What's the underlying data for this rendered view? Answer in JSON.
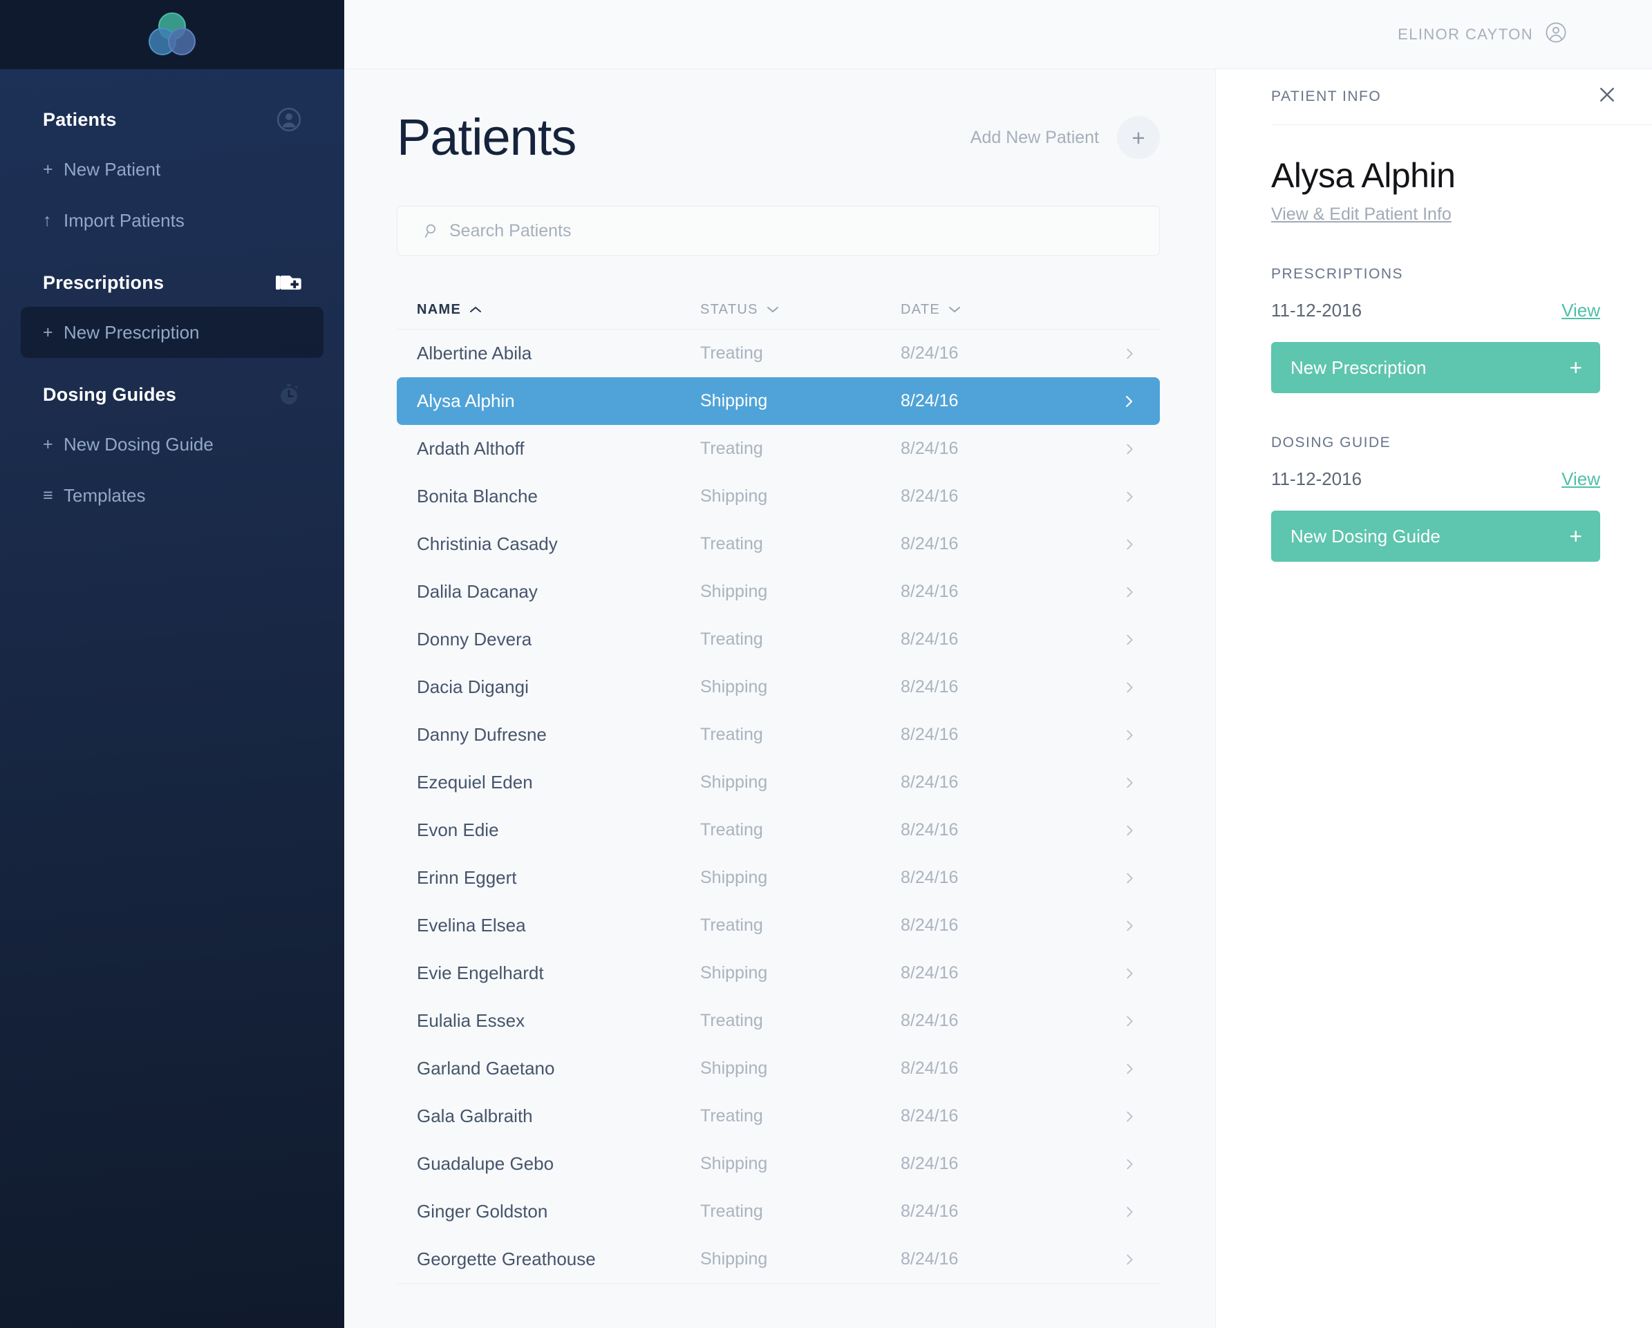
{
  "brand": {
    "logo_name": "three-circles-logo",
    "colors": {
      "sidebar_top": "#101A2E",
      "sidebar_body": "#1D3158",
      "accent_green": "#5EC5AE",
      "accent_blue": "#4FA3D8",
      "page_bg": "#F7F9FB",
      "panel_bg": "#FFFFFF",
      "title_navy": "#16233C"
    }
  },
  "topbar": {
    "user_name": "ELINOR CAYTON",
    "user_icon": "user-circle-icon"
  },
  "sidebar": {
    "groups": [
      {
        "label": "Patients",
        "icon": "user-circle-icon",
        "items": [
          {
            "marker": "+",
            "label": "New Patient",
            "active": false
          },
          {
            "marker": "↑",
            "label": "Import Patients",
            "active": false
          }
        ]
      },
      {
        "label": "Prescriptions",
        "icon": "medical-bag-icon",
        "items": [
          {
            "marker": "+",
            "label": "New Prescription",
            "active": true
          }
        ]
      },
      {
        "label": "Dosing Guides",
        "icon": "stopwatch-icon",
        "items": [
          {
            "marker": "+",
            "label": "New Dosing Guide",
            "active": false
          },
          {
            "marker": "≡",
            "label": "Templates",
            "active": false
          }
        ]
      }
    ]
  },
  "main": {
    "page_title": "Patients",
    "add_patient_label": "Add New Patient",
    "add_patient_plus": "+",
    "search": {
      "placeholder": "Search Patients",
      "value": "",
      "icon": "search-icon"
    },
    "table": {
      "columns": [
        {
          "label": "NAME",
          "sort": "asc",
          "caret": "⌃"
        },
        {
          "label": "STATUS",
          "sort": "none",
          "caret": "⌄"
        },
        {
          "label": "DATE",
          "sort": "none",
          "caret": "⌄"
        }
      ],
      "rows": [
        {
          "name": "Albertine Abila",
          "status": "Treating",
          "date": "8/24/16",
          "selected": false
        },
        {
          "name": "Alysa Alphin",
          "status": "Shipping",
          "date": "8/24/16",
          "selected": true
        },
        {
          "name": "Ardath Althoff",
          "status": "Treating",
          "date": "8/24/16",
          "selected": false
        },
        {
          "name": "Bonita Blanche",
          "status": "Shipping",
          "date": "8/24/16",
          "selected": false
        },
        {
          "name": "Christinia Casady",
          "status": "Treating",
          "date": "8/24/16",
          "selected": false
        },
        {
          "name": "Dalila Dacanay",
          "status": "Shipping",
          "date": "8/24/16",
          "selected": false
        },
        {
          "name": "Donny Devera",
          "status": "Treating",
          "date": "8/24/16",
          "selected": false
        },
        {
          "name": "Dacia Digangi",
          "status": "Shipping",
          "date": "8/24/16",
          "selected": false
        },
        {
          "name": "Danny Dufresne",
          "status": "Treating",
          "date": "8/24/16",
          "selected": false
        },
        {
          "name": "Ezequiel Eden",
          "status": "Shipping",
          "date": "8/24/16",
          "selected": false
        },
        {
          "name": "Evon Edie",
          "status": "Treating",
          "date": "8/24/16",
          "selected": false
        },
        {
          "name": "Erinn Eggert",
          "status": "Shipping",
          "date": "8/24/16",
          "selected": false
        },
        {
          "name": "Evelina Elsea",
          "status": "Treating",
          "date": "8/24/16",
          "selected": false
        },
        {
          "name": "Evie Engelhardt",
          "status": "Shipping",
          "date": "8/24/16",
          "selected": false
        },
        {
          "name": "Eulalia Essex",
          "status": "Treating",
          "date": "8/24/16",
          "selected": false
        },
        {
          "name": "Garland Gaetano",
          "status": "Shipping",
          "date": "8/24/16",
          "selected": false
        },
        {
          "name": "Gala Galbraith",
          "status": "Treating",
          "date": "8/24/16",
          "selected": false
        },
        {
          "name": "Guadalupe Gebo",
          "status": "Shipping",
          "date": "8/24/16",
          "selected": false
        },
        {
          "name": "Ginger Goldston",
          "status": "Treating",
          "date": "8/24/16",
          "selected": false
        },
        {
          "name": "Georgette Greathouse",
          "status": "Shipping",
          "date": "8/24/16",
          "selected": false
        }
      ]
    }
  },
  "panel": {
    "header_title": "PATIENT INFO",
    "close_icon": "close-icon",
    "patient_name": "Alysa Alphin",
    "edit_link": "View & Edit Patient Info",
    "sections": [
      {
        "label": "PRESCRIPTIONS",
        "date": "11-12-2016",
        "view_label": "View",
        "button_label": "New Prescription",
        "button_plus": "+"
      },
      {
        "label": "DOSING GUIDE",
        "date": "11-12-2016",
        "view_label": "View",
        "button_label": "New Dosing Guide",
        "button_plus": "+"
      }
    ]
  }
}
